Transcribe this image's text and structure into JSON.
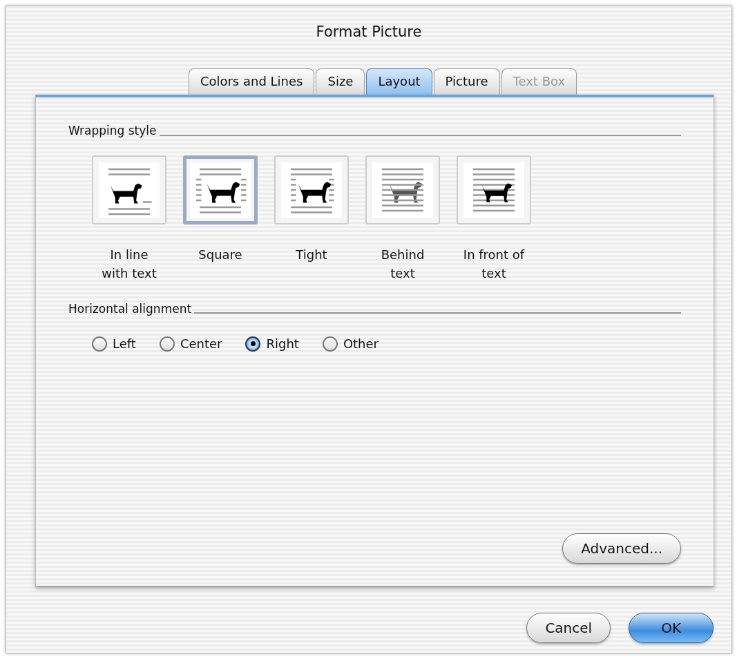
{
  "window": {
    "title": "Format Picture"
  },
  "tabs": [
    {
      "label": "Colors and Lines",
      "selected": false,
      "disabled": false
    },
    {
      "label": "Size",
      "selected": false,
      "disabled": false
    },
    {
      "label": "Layout",
      "selected": true,
      "disabled": false
    },
    {
      "label": "Picture",
      "selected": false,
      "disabled": false
    },
    {
      "label": "Text Box",
      "selected": false,
      "disabled": true
    }
  ],
  "wrapping_style": {
    "heading": "Wrapping style",
    "options": [
      {
        "kind": "in-line",
        "label": "In line\nwith text",
        "selected": false
      },
      {
        "kind": "square",
        "label": "Square",
        "selected": true
      },
      {
        "kind": "tight",
        "label": "Tight",
        "selected": false
      },
      {
        "kind": "behind",
        "label": "Behind\ntext",
        "selected": false
      },
      {
        "kind": "in-front",
        "label": "In front of\ntext",
        "selected": false
      }
    ]
  },
  "horizontal_alignment": {
    "heading": "Horizontal alignment",
    "options": [
      {
        "label": "Left",
        "selected": false
      },
      {
        "label": "Center",
        "selected": false
      },
      {
        "label": "Right",
        "selected": true
      },
      {
        "label": "Other",
        "selected": false
      }
    ]
  },
  "panel_buttons": [
    {
      "label": "Advanced...",
      "default": false
    }
  ],
  "dialog_buttons": [
    {
      "label": "Cancel",
      "default": false
    },
    {
      "label": "OK",
      "default": true
    }
  ]
}
